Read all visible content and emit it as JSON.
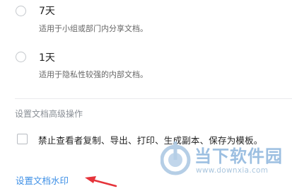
{
  "options": [
    {
      "title": "7天",
      "desc": "适用于小组或部门内分享文档。"
    },
    {
      "title": "1天",
      "desc": "适用于隐私性较强的内部文档。"
    }
  ],
  "advanced": {
    "section_title": "设置文档高级操作",
    "checkbox_label": "禁止查看者复制、导出、打印、生成副本、保存为模板。"
  },
  "watermark_link": "设置文档水印",
  "site_watermark": {
    "brand": "当下软件园",
    "url": "www.downxia.com"
  },
  "colors": {
    "link": "#3d8fe6",
    "arrow": "#e5333a",
    "watermark": "#8bb4dc"
  }
}
